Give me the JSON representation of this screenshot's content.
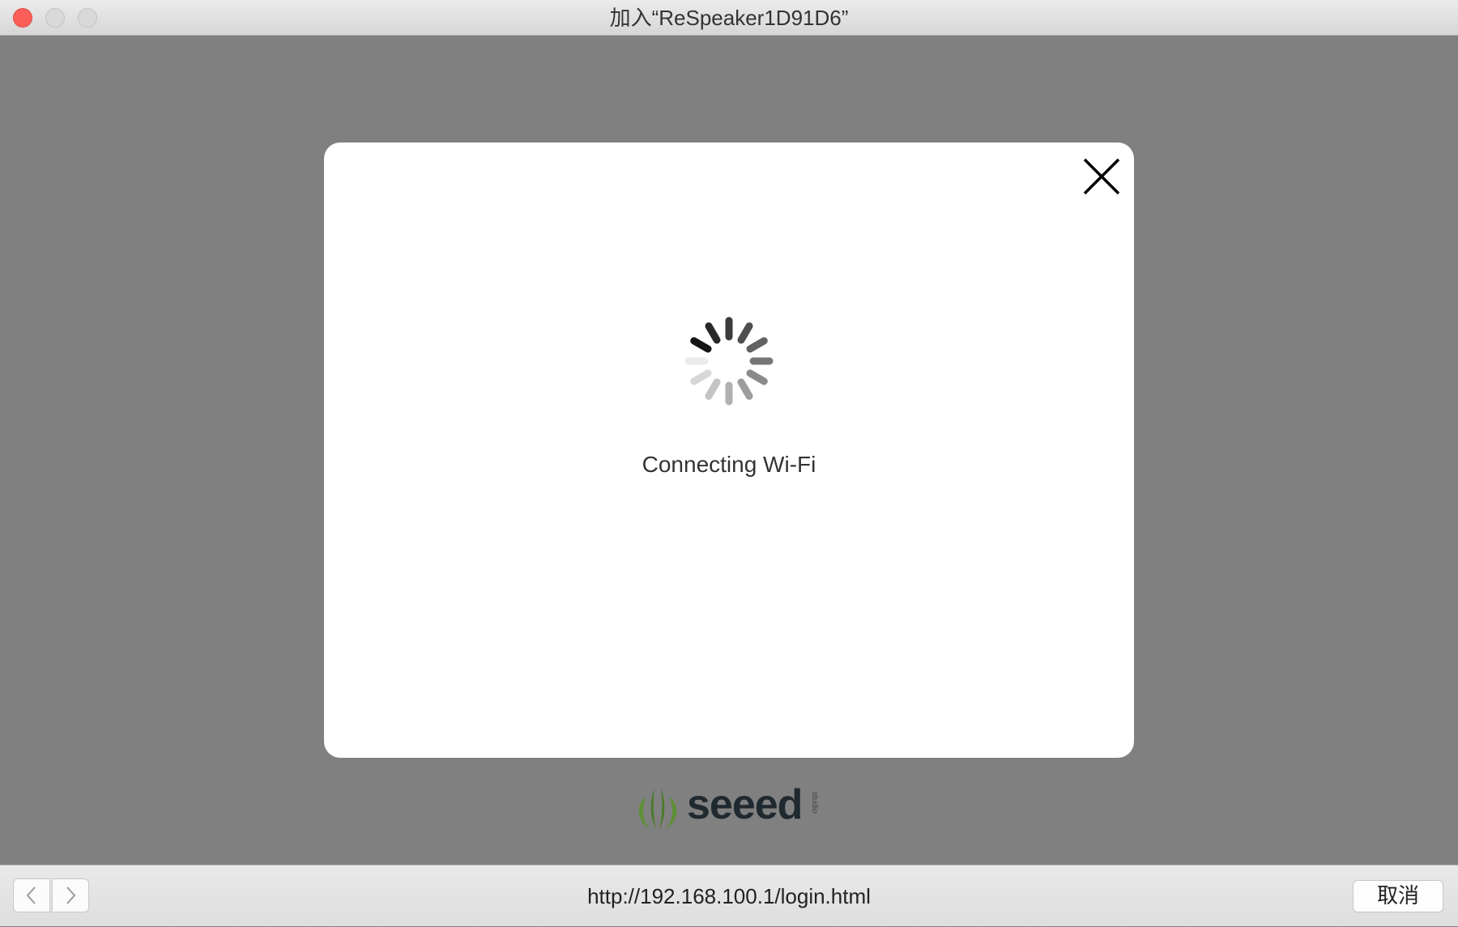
{
  "window": {
    "title": "加入“ReSpeaker1D91D6”"
  },
  "dialog": {
    "status_text": "Connecting Wi-Fi"
  },
  "logo": {
    "name": "seeed",
    "sub": "studio"
  },
  "bottom_bar": {
    "url": "http://192.168.100.1/login.html",
    "cancel_label": "取消"
  },
  "colors": {
    "overlay_bg": "#808080",
    "logo_green": "#4a7a2a",
    "logo_text": "#1f2a30"
  }
}
